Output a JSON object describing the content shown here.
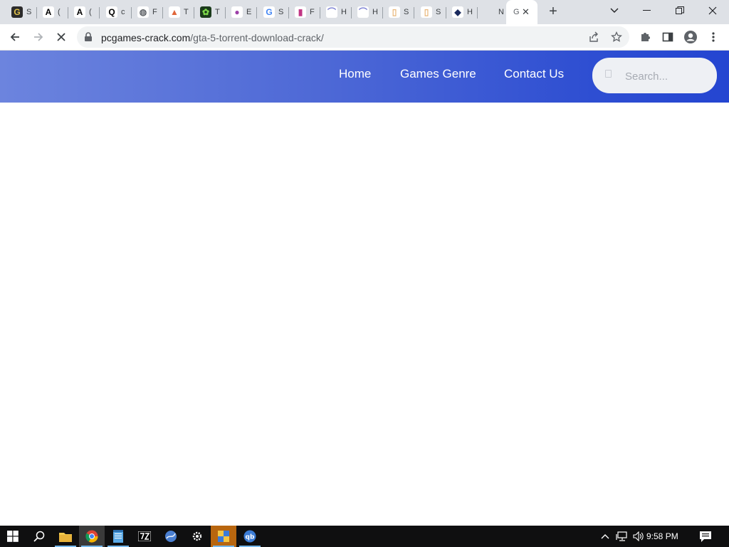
{
  "browser": {
    "tabs": [
      {
        "favicon_letter": "G",
        "favicon_bg": "#2b2b2b",
        "favicon_fg": "#e2c34a",
        "title_char": "S"
      },
      {
        "favicon_letter": "A",
        "favicon_bg": "#ffffff",
        "favicon_fg": "#000000",
        "title_char": "("
      },
      {
        "favicon_letter": "A",
        "favicon_bg": "#ffffff",
        "favicon_fg": "#000000",
        "title_char": "("
      },
      {
        "favicon_letter": "Q",
        "favicon_bg": "#ffffff",
        "favicon_fg": "#000000",
        "title_char": "c"
      },
      {
        "favicon_letter": "◍",
        "favicon_bg": "#ffffff",
        "favicon_fg": "#5f6368",
        "title_char": "F"
      },
      {
        "favicon_letter": "▲",
        "favicon_bg": "#ffffff",
        "favicon_fg": "#e0663a",
        "title_char": "T"
      },
      {
        "favicon_letter": "✿",
        "favicon_bg": "#1b3b1b",
        "favicon_fg": "#7fdc4a",
        "title_char": "T"
      },
      {
        "favicon_letter": "●",
        "favicon_bg": "#ffffff",
        "favicon_fg": "#9c3fa8",
        "title_char": "E"
      },
      {
        "favicon_letter": "G",
        "favicon_bg": "#ffffff",
        "favicon_fg": "#4285f4",
        "title_char": "S"
      },
      {
        "favicon_letter": "▮",
        "favicon_bg": "#ffffff",
        "favicon_fg": "#c13584",
        "title_char": "F"
      },
      {
        "favicon_letter": "⌒",
        "favicon_bg": "#ffffff",
        "favicon_fg": "#7b7fd4",
        "title_char": "H"
      },
      {
        "favicon_letter": "⌒",
        "favicon_bg": "#ffffff",
        "favicon_fg": "#7b7fd4",
        "title_char": "H"
      },
      {
        "favicon_letter": "▯",
        "favicon_bg": "#ffffff",
        "favicon_fg": "#e8b77a",
        "title_char": "S"
      },
      {
        "favicon_letter": "▯",
        "favicon_bg": "#ffffff",
        "favicon_fg": "#e8b77a",
        "title_char": "S"
      },
      {
        "favicon_letter": "◆",
        "favicon_bg": "#ffffff",
        "favicon_fg": "#1a2a5e",
        "title_char": "H"
      },
      {
        "favicon_letter": "",
        "favicon_bg": "transparent",
        "favicon_fg": "#5f6368",
        "title_char": "N"
      }
    ],
    "active_tab": {
      "title_char": "G"
    },
    "url_domain": "pcgames-crack.com",
    "url_path": "/gta-5-torrent-download-crack/"
  },
  "site": {
    "nav": {
      "home": "Home",
      "genre": "Games Genre",
      "contact": "Contact Us"
    },
    "search_placeholder": "Search..."
  },
  "taskbar": {
    "time": "9:58 PM"
  },
  "colors": {
    "header_start": "#6c84de",
    "header_end": "#2445d1"
  }
}
